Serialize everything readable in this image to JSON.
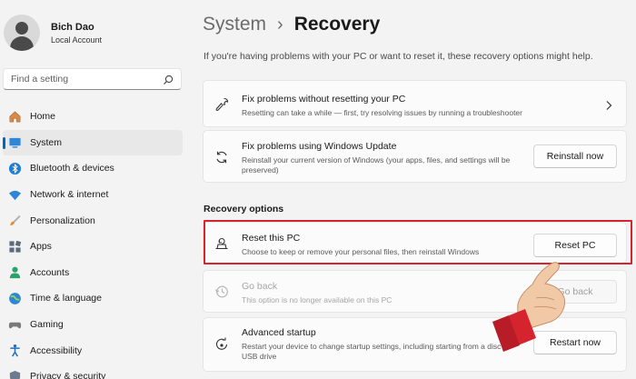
{
  "profile": {
    "name": "Bich Dao",
    "account_type": "Local Account"
  },
  "search": {
    "placeholder": "Find a setting",
    "icon": "search-icon"
  },
  "sidebar": {
    "items": [
      {
        "label": "Home",
        "icon": "home-icon"
      },
      {
        "label": "System",
        "icon": "system-icon",
        "active": true
      },
      {
        "label": "Bluetooth & devices",
        "icon": "bluetooth-icon"
      },
      {
        "label": "Network & internet",
        "icon": "wifi-icon"
      },
      {
        "label": "Personalization",
        "icon": "brush-icon"
      },
      {
        "label": "Apps",
        "icon": "apps-icon"
      },
      {
        "label": "Accounts",
        "icon": "account-icon"
      },
      {
        "label": "Time & language",
        "icon": "globe-icon"
      },
      {
        "label": "Gaming",
        "icon": "gaming-icon"
      },
      {
        "label": "Accessibility",
        "icon": "accessibility-icon"
      },
      {
        "label": "Privacy & security",
        "icon": "shield-icon"
      }
    ]
  },
  "header": {
    "parent": "System",
    "separator": "›",
    "current": "Recovery",
    "description": "If you're having problems with your PC or want to reset it, these recovery options might help."
  },
  "cards": {
    "fix_problems": {
      "title": "Fix problems without resetting your PC",
      "desc": "Resetting can take a while — first, try resolving issues by running a troubleshooter",
      "icon": "wrench-icon"
    },
    "windows_update": {
      "title": "Fix problems using Windows Update",
      "desc": "Reinstall your current version of Windows (your apps, files, and settings will be preserved)",
      "button": "Reinstall now",
      "icon": "sync-icon"
    }
  },
  "recovery_options": {
    "heading": "Recovery options",
    "reset": {
      "title": "Reset this PC",
      "desc": "Choose to keep or remove your personal files, then reinstall Windows",
      "button": "Reset PC",
      "icon": "reset-pc-icon"
    },
    "go_back": {
      "title": "Go back",
      "desc": "This option is no longer available on this PC",
      "button": "Go back",
      "icon": "history-icon",
      "enabled": false
    },
    "advanced": {
      "title": "Advanced startup",
      "desc": "Restart your device to change startup settings, including starting from a disc or USB drive",
      "button": "Restart now",
      "icon": "restart-icon"
    }
  },
  "colors": {
    "accent": "#0067c0",
    "highlight_border": "#d6242f",
    "hand_cuff": "#d6242f"
  }
}
